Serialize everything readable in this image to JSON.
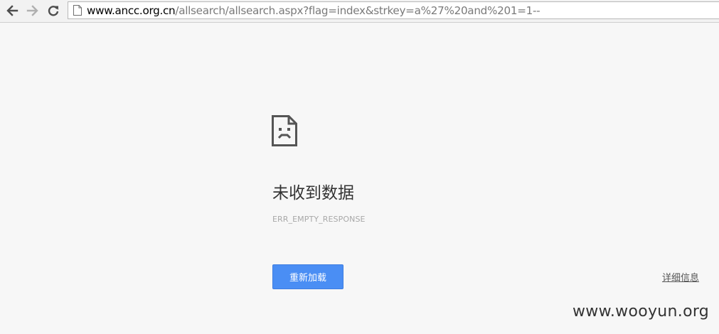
{
  "browser": {
    "url_host": "www.ancc.org.cn",
    "url_path": "/allsearch/allsearch.aspx?flag=index&strkey=a%27%20and%201=1--",
    "back_icon": "arrow-left-icon",
    "forward_icon": "arrow-right-icon",
    "reload_icon": "reload-icon",
    "page_icon": "page-icon"
  },
  "error": {
    "icon": "sad-page-icon",
    "title": "未收到数据",
    "code": "ERR_EMPTY_RESPONSE",
    "reload_label": "重新加载",
    "details_label": "详细信息",
    "reload_button_color": "#4a8ef4"
  },
  "watermark": {
    "text": "www.wooyun.org"
  }
}
